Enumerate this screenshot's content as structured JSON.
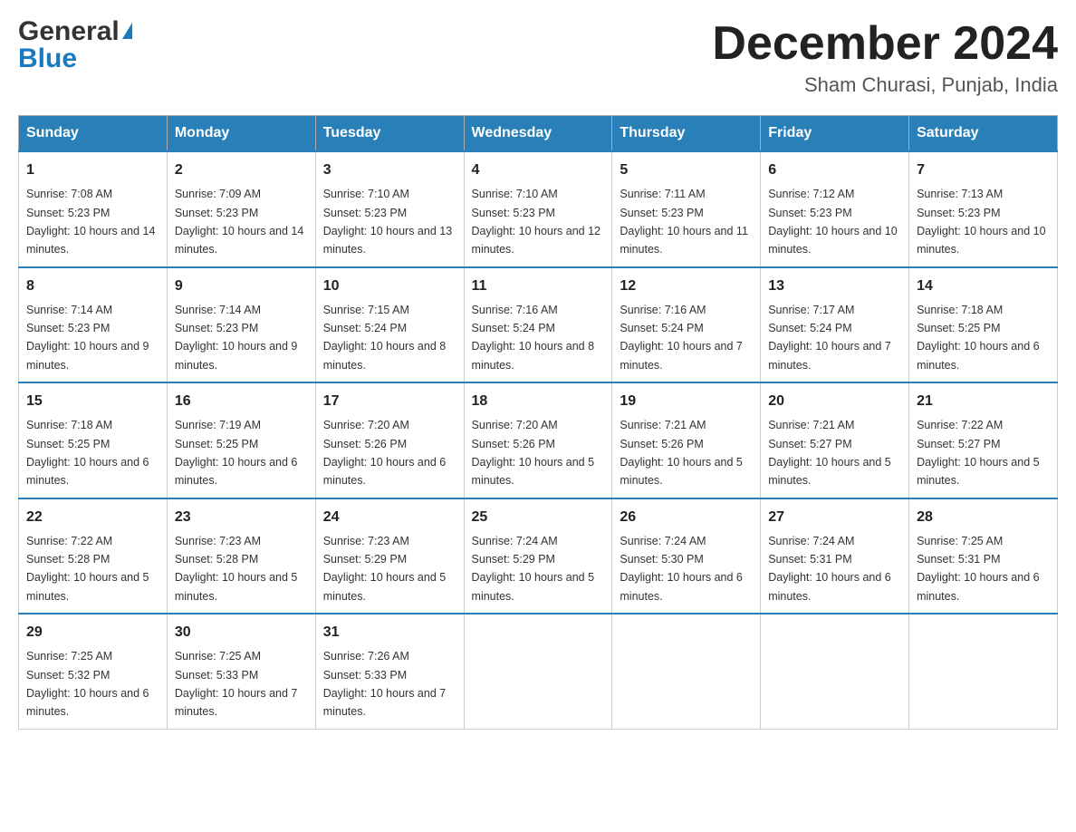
{
  "header": {
    "logo_general": "General",
    "logo_blue": "Blue",
    "month_title": "December 2024",
    "subtitle": "Sham Churasi, Punjab, India"
  },
  "calendar": {
    "days_of_week": [
      "Sunday",
      "Monday",
      "Tuesday",
      "Wednesday",
      "Thursday",
      "Friday",
      "Saturday"
    ],
    "weeks": [
      [
        {
          "day": "1",
          "sunrise": "7:08 AM",
          "sunset": "5:23 PM",
          "daylight": "10 hours and 14 minutes."
        },
        {
          "day": "2",
          "sunrise": "7:09 AM",
          "sunset": "5:23 PM",
          "daylight": "10 hours and 14 minutes."
        },
        {
          "day": "3",
          "sunrise": "7:10 AM",
          "sunset": "5:23 PM",
          "daylight": "10 hours and 13 minutes."
        },
        {
          "day": "4",
          "sunrise": "7:10 AM",
          "sunset": "5:23 PM",
          "daylight": "10 hours and 12 minutes."
        },
        {
          "day": "5",
          "sunrise": "7:11 AM",
          "sunset": "5:23 PM",
          "daylight": "10 hours and 11 minutes."
        },
        {
          "day": "6",
          "sunrise": "7:12 AM",
          "sunset": "5:23 PM",
          "daylight": "10 hours and 10 minutes."
        },
        {
          "day": "7",
          "sunrise": "7:13 AM",
          "sunset": "5:23 PM",
          "daylight": "10 hours and 10 minutes."
        }
      ],
      [
        {
          "day": "8",
          "sunrise": "7:14 AM",
          "sunset": "5:23 PM",
          "daylight": "10 hours and 9 minutes."
        },
        {
          "day": "9",
          "sunrise": "7:14 AM",
          "sunset": "5:23 PM",
          "daylight": "10 hours and 9 minutes."
        },
        {
          "day": "10",
          "sunrise": "7:15 AM",
          "sunset": "5:24 PM",
          "daylight": "10 hours and 8 minutes."
        },
        {
          "day": "11",
          "sunrise": "7:16 AM",
          "sunset": "5:24 PM",
          "daylight": "10 hours and 8 minutes."
        },
        {
          "day": "12",
          "sunrise": "7:16 AM",
          "sunset": "5:24 PM",
          "daylight": "10 hours and 7 minutes."
        },
        {
          "day": "13",
          "sunrise": "7:17 AM",
          "sunset": "5:24 PM",
          "daylight": "10 hours and 7 minutes."
        },
        {
          "day": "14",
          "sunrise": "7:18 AM",
          "sunset": "5:25 PM",
          "daylight": "10 hours and 6 minutes."
        }
      ],
      [
        {
          "day": "15",
          "sunrise": "7:18 AM",
          "sunset": "5:25 PM",
          "daylight": "10 hours and 6 minutes."
        },
        {
          "day": "16",
          "sunrise": "7:19 AM",
          "sunset": "5:25 PM",
          "daylight": "10 hours and 6 minutes."
        },
        {
          "day": "17",
          "sunrise": "7:20 AM",
          "sunset": "5:26 PM",
          "daylight": "10 hours and 6 minutes."
        },
        {
          "day": "18",
          "sunrise": "7:20 AM",
          "sunset": "5:26 PM",
          "daylight": "10 hours and 5 minutes."
        },
        {
          "day": "19",
          "sunrise": "7:21 AM",
          "sunset": "5:26 PM",
          "daylight": "10 hours and 5 minutes."
        },
        {
          "day": "20",
          "sunrise": "7:21 AM",
          "sunset": "5:27 PM",
          "daylight": "10 hours and 5 minutes."
        },
        {
          "day": "21",
          "sunrise": "7:22 AM",
          "sunset": "5:27 PM",
          "daylight": "10 hours and 5 minutes."
        }
      ],
      [
        {
          "day": "22",
          "sunrise": "7:22 AM",
          "sunset": "5:28 PM",
          "daylight": "10 hours and 5 minutes."
        },
        {
          "day": "23",
          "sunrise": "7:23 AM",
          "sunset": "5:28 PM",
          "daylight": "10 hours and 5 minutes."
        },
        {
          "day": "24",
          "sunrise": "7:23 AM",
          "sunset": "5:29 PM",
          "daylight": "10 hours and 5 minutes."
        },
        {
          "day": "25",
          "sunrise": "7:24 AM",
          "sunset": "5:29 PM",
          "daylight": "10 hours and 5 minutes."
        },
        {
          "day": "26",
          "sunrise": "7:24 AM",
          "sunset": "5:30 PM",
          "daylight": "10 hours and 6 minutes."
        },
        {
          "day": "27",
          "sunrise": "7:24 AM",
          "sunset": "5:31 PM",
          "daylight": "10 hours and 6 minutes."
        },
        {
          "day": "28",
          "sunrise": "7:25 AM",
          "sunset": "5:31 PM",
          "daylight": "10 hours and 6 minutes."
        }
      ],
      [
        {
          "day": "29",
          "sunrise": "7:25 AM",
          "sunset": "5:32 PM",
          "daylight": "10 hours and 6 minutes."
        },
        {
          "day": "30",
          "sunrise": "7:25 AM",
          "sunset": "5:33 PM",
          "daylight": "10 hours and 7 minutes."
        },
        {
          "day": "31",
          "sunrise": "7:26 AM",
          "sunset": "5:33 PM",
          "daylight": "10 hours and 7 minutes."
        },
        null,
        null,
        null,
        null
      ]
    ]
  }
}
